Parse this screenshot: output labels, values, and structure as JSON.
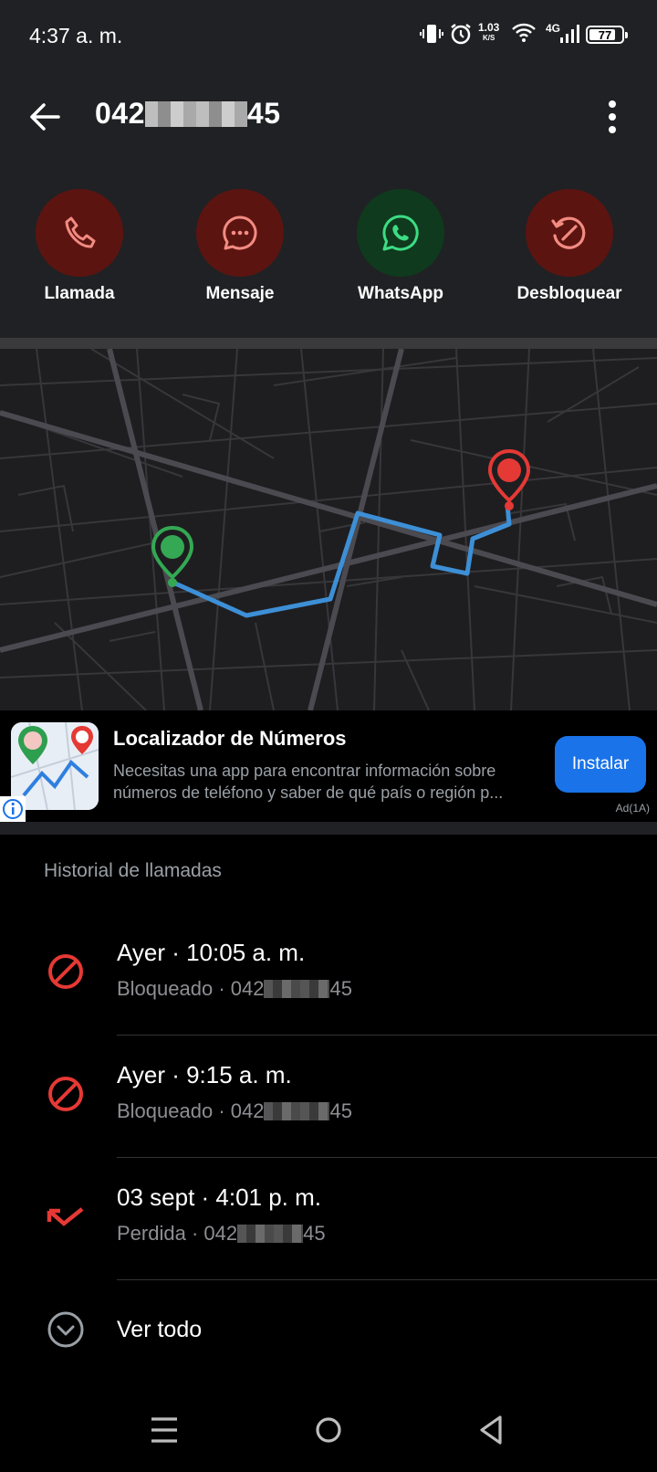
{
  "status_bar": {
    "time": "4:37 a. m.",
    "net_speed_value": "1.03",
    "net_speed_unit": "K/S",
    "network_type": "4G",
    "battery": "77"
  },
  "header": {
    "phone_prefix": "042",
    "phone_suffix": "45"
  },
  "actions": [
    {
      "label": "Llamada",
      "icon": "phone-icon",
      "bg": "#5c1410",
      "fg": "#f28b82"
    },
    {
      "label": "Mensaje",
      "icon": "message-icon",
      "bg": "#5c1410",
      "fg": "#f28b82"
    },
    {
      "label": "WhatsApp",
      "icon": "whatsapp-icon",
      "bg": "#0f3a1e",
      "fg": "#3ddc84"
    },
    {
      "label": "Desbloquear",
      "icon": "unblock-icon",
      "bg": "#5c1410",
      "fg": "#f28b82"
    }
  ],
  "ad": {
    "title": "Localizador de Números",
    "description_line1": "Necesitas una app para encontrar información sobre",
    "description_line2": "números de teléfono y saber de qué país o región p...",
    "button": "Instalar",
    "badge": "Ad(1A)"
  },
  "history": {
    "title": "Historial de llamadas",
    "calls": [
      {
        "primary": "Ayer · 10:05 a. m.",
        "status": "Bloqueado · ",
        "num_prefix": "042",
        "num_suffix": "45",
        "icon": "blocked-icon"
      },
      {
        "primary": "Ayer · 9:15 a. m.",
        "status": "Bloqueado · ",
        "num_prefix": "042",
        "num_suffix": "45",
        "icon": "blocked-icon"
      },
      {
        "primary": "03 sept · 4:01 p. m.",
        "status": "Perdida · ",
        "num_prefix": "042",
        "num_suffix": "45",
        "icon": "missed-call-icon"
      }
    ],
    "see_all": "Ver todo"
  },
  "colors": {
    "accent_red": "#e53935",
    "route_blue": "#3d8fd6",
    "ad_button": "#1a73e8"
  }
}
